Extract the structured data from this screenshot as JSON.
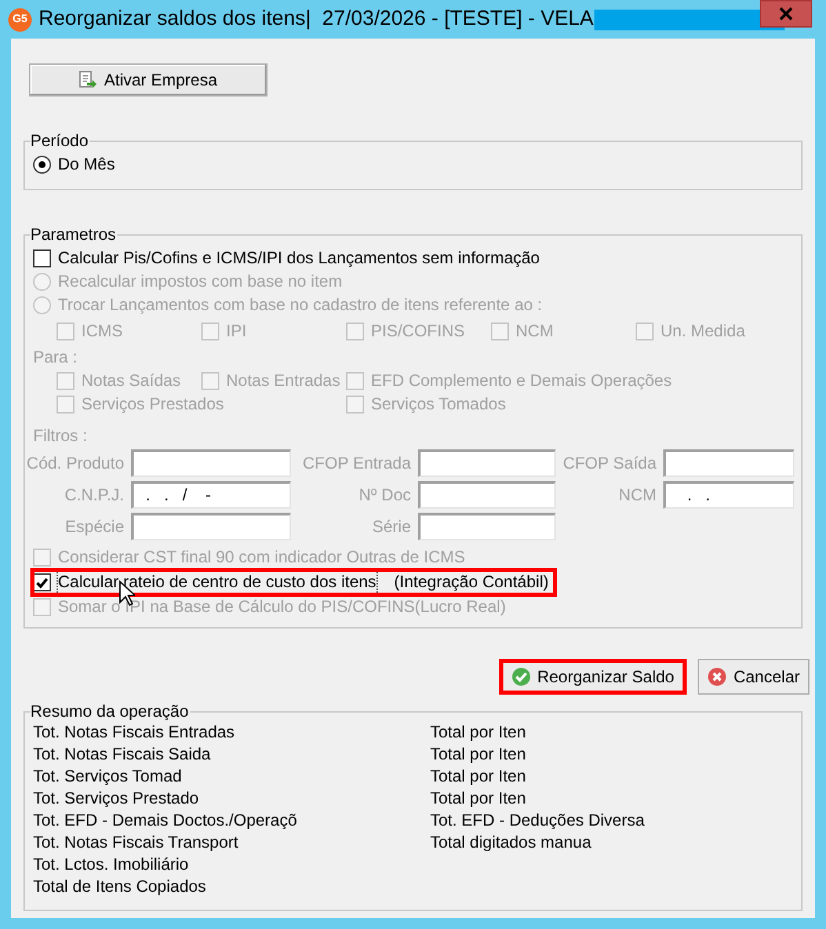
{
  "window": {
    "app_badge": "G5",
    "title": "Reorganizar saldos dos itens|  27/03/2026 - [TESTE] - VELA"
  },
  "activate_button": {
    "label": "Ativar Empresa"
  },
  "period": {
    "title": "Período",
    "options": [
      {
        "label": "Do Mês",
        "selected": true
      }
    ]
  },
  "parameters": {
    "title": "Parametros",
    "calc_option": {
      "label": "Calcular Pis/Cofins e ICMS/IPI dos Lançamentos sem informação",
      "checked": false,
      "disabled": false
    },
    "radios": [
      {
        "label": "Recalcular impostos com base no item",
        "selected": false,
        "disabled": true
      },
      {
        "label": "Trocar Lançamentos com base no cadastro de itens referente ao :",
        "selected": false,
        "disabled": true
      }
    ],
    "field_checks": [
      {
        "label": "ICMS",
        "checked": false,
        "disabled": true
      },
      {
        "label": "IPI",
        "checked": false,
        "disabled": true
      },
      {
        "label": "PIS/COFINS",
        "checked": false,
        "disabled": true
      },
      {
        "label": "NCM",
        "checked": false,
        "disabled": true
      },
      {
        "label": "Un. Medida",
        "checked": false,
        "disabled": true
      }
    ],
    "para_label": "Para :",
    "para_checks": [
      {
        "label": "Notas Saídas",
        "checked": false,
        "disabled": true
      },
      {
        "label": "Notas Entradas",
        "checked": false,
        "disabled": true
      },
      {
        "label": "EFD Complemento e Demais Operações",
        "checked": false,
        "disabled": true
      },
      {
        "label": "Serviços Prestados",
        "checked": false,
        "disabled": true
      },
      {
        "label": "Serviços Tomados",
        "checked": false,
        "disabled": true
      }
    ],
    "filters_label": "Filtros :",
    "filters": [
      {
        "label": "Cód. Produto"
      },
      {
        "label": "CFOP Entrada"
      },
      {
        "label": "CFOP Saída"
      },
      {
        "label": "C.N.P.J.",
        "value": "  .   .   /    -"
      },
      {
        "label": "Nº Doc"
      },
      {
        "label": "NCM",
        "value": "    .   ."
      },
      {
        "label": "Espécie"
      },
      {
        "label": "Série"
      }
    ],
    "options": [
      {
        "label": "Considerar CST final 90 com indicador Outras de ICMS",
        "checked": false,
        "disabled": true,
        "highlighted": false,
        "focused": false
      },
      {
        "label": "Calcular rateio de centro de custo dos itens",
        "note": "(Integração Contábil)",
        "checked": true,
        "disabled": false,
        "highlighted": true,
        "focused": true
      },
      {
        "label": "Somar o IPI na Base de Cálculo do PIS/COFINS(Lucro Real)",
        "checked": false,
        "disabled": true,
        "highlighted": false,
        "focused": false
      }
    ]
  },
  "actions": [
    {
      "label": "Reorganizar Saldo",
      "kind": "confirm",
      "highlighted": true
    },
    {
      "label": "Cancelar",
      "kind": "cancel",
      "highlighted": false
    }
  ],
  "summary": {
    "title": "Resumo da operação",
    "left": [
      "Tot. Notas Fiscais Entradas",
      "Tot. Notas Fiscais Saida",
      "Tot. Serviços Tomad",
      "Tot. Serviços Prestado",
      "Tot. EFD - Demais Doctos./Operaçõ",
      "Tot. Notas Fiscais Transport",
      "Tot. Lctos. Imobiliário",
      "Total de Itens Copiados"
    ],
    "right": [
      "Total por Iten",
      "Total por Iten",
      "Total por Iten",
      "Total por Iten",
      "Tot. EFD - Deduções Diversa",
      "Total digitados manua"
    ]
  }
}
